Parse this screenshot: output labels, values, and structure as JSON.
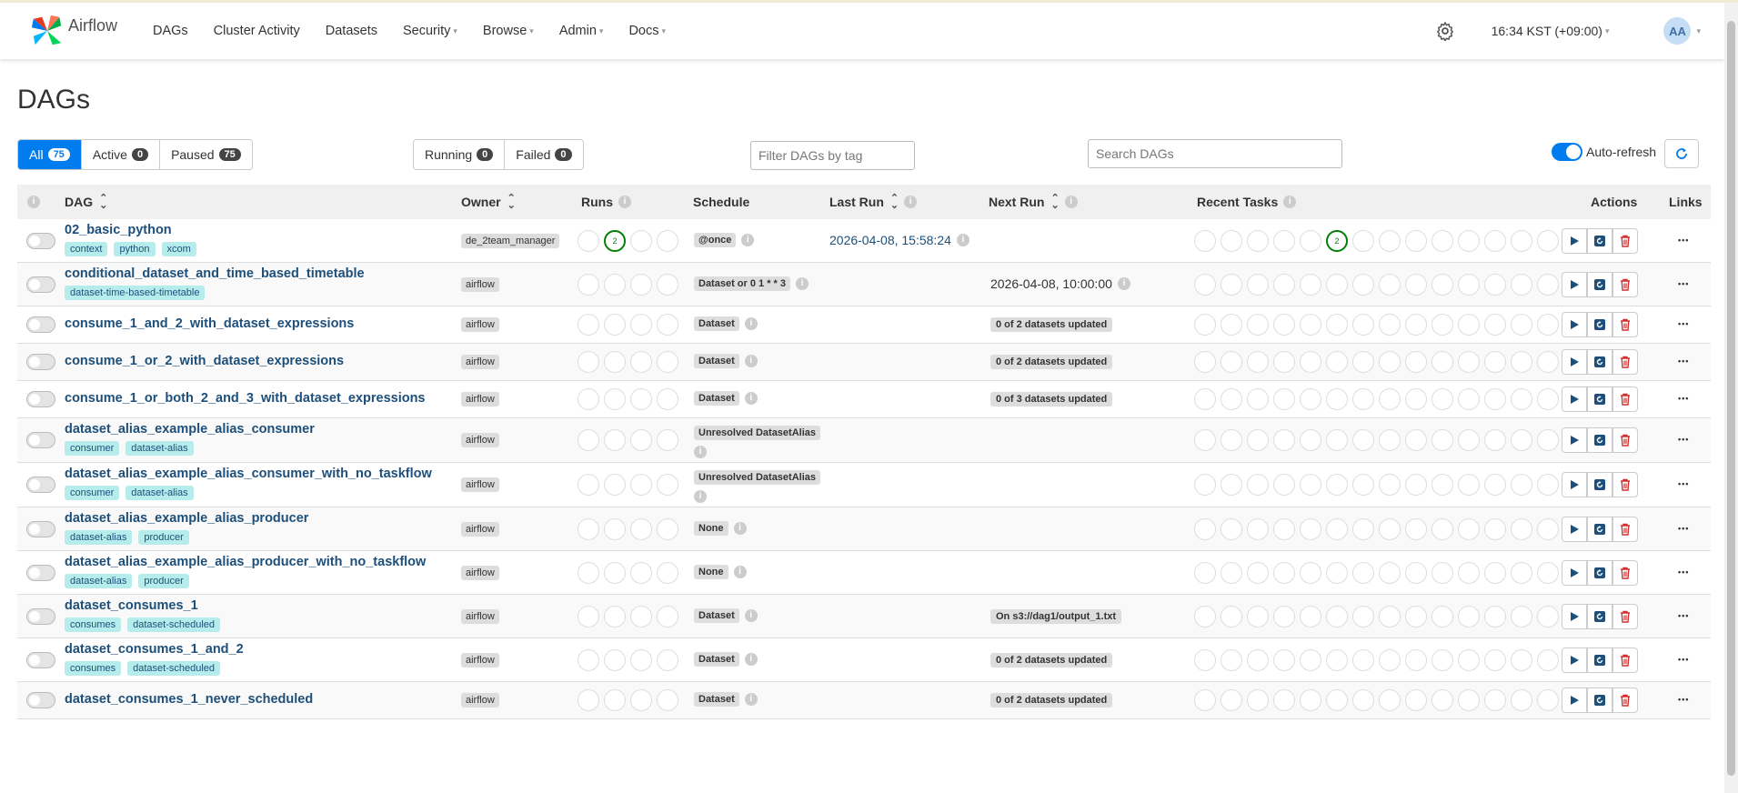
{
  "navbar": {
    "brand": "Airflow",
    "items": [
      {
        "label": "DAGs",
        "dropdown": false
      },
      {
        "label": "Cluster Activity",
        "dropdown": false
      },
      {
        "label": "Datasets",
        "dropdown": false
      },
      {
        "label": "Security",
        "dropdown": true
      },
      {
        "label": "Browse",
        "dropdown": true
      },
      {
        "label": "Admin",
        "dropdown": true
      },
      {
        "label": "Docs",
        "dropdown": true
      }
    ],
    "timezone": "16:34 KST (+09:00)",
    "user_initials": "AA"
  },
  "page": {
    "title": "DAGs",
    "status_filters": [
      {
        "label": "All",
        "count": "75"
      },
      {
        "label": "Active",
        "count": "0"
      },
      {
        "label": "Paused",
        "count": "75"
      }
    ],
    "run_filters": [
      {
        "label": "Running",
        "count": "0"
      },
      {
        "label": "Failed",
        "count": "0"
      }
    ],
    "tag_filter_placeholder": "Filter DAGs by tag",
    "search_placeholder": "Search DAGs",
    "auto_refresh_label": "Auto-refresh"
  },
  "table": {
    "headers": {
      "dag": "DAG",
      "owner": "Owner",
      "runs": "Runs",
      "schedule": "Schedule",
      "last_run": "Last Run",
      "next_run": "Next Run",
      "recent_tasks": "Recent Tasks",
      "actions": "Actions",
      "links": "Links"
    },
    "rows": [
      {
        "name": "02_basic_python",
        "tags": [
          "context",
          "python",
          "xcom"
        ],
        "owner": "de_2team_manager",
        "schedule": "@once",
        "last_run": "2026-04-08, 15:58:24",
        "next_run": "",
        "next_run_badge": "",
        "runs_success": "2",
        "tasks_success": "2"
      },
      {
        "name": "conditional_dataset_and_time_based_timetable",
        "tags": [
          "dataset-time-based-timetable"
        ],
        "owner": "airflow",
        "schedule": "Dataset or 0 1 * * 3",
        "last_run": "",
        "next_run": "2026-04-08, 10:00:00",
        "next_run_badge": "",
        "runs_success": "",
        "tasks_success": ""
      },
      {
        "name": "consume_1_and_2_with_dataset_expressions",
        "tags": [],
        "owner": "airflow",
        "schedule": "Dataset",
        "last_run": "",
        "next_run": "",
        "next_run_badge": "0 of 2 datasets updated",
        "runs_success": "",
        "tasks_success": ""
      },
      {
        "name": "consume_1_or_2_with_dataset_expressions",
        "tags": [],
        "owner": "airflow",
        "schedule": "Dataset",
        "last_run": "",
        "next_run": "",
        "next_run_badge": "0 of 2 datasets updated",
        "runs_success": "",
        "tasks_success": ""
      },
      {
        "name": "consume_1_or_both_2_and_3_with_dataset_expressions",
        "tags": [],
        "owner": "airflow",
        "schedule": "Dataset",
        "last_run": "",
        "next_run": "",
        "next_run_badge": "0 of 3 datasets updated",
        "runs_success": "",
        "tasks_success": ""
      },
      {
        "name": "dataset_alias_example_alias_consumer",
        "tags": [
          "consumer",
          "dataset-alias"
        ],
        "owner": "airflow",
        "schedule": "Unresolved DatasetAlias",
        "last_run": "",
        "next_run": "",
        "next_run_badge": "",
        "runs_success": "",
        "tasks_success": ""
      },
      {
        "name": "dataset_alias_example_alias_consumer_with_no_taskflow",
        "tags": [
          "consumer",
          "dataset-alias"
        ],
        "owner": "airflow",
        "schedule": "Unresolved DatasetAlias",
        "last_run": "",
        "next_run": "",
        "next_run_badge": "",
        "runs_success": "",
        "tasks_success": ""
      },
      {
        "name": "dataset_alias_example_alias_producer",
        "tags": [
          "dataset-alias",
          "producer"
        ],
        "owner": "airflow",
        "schedule": "None",
        "last_run": "",
        "next_run": "",
        "next_run_badge": "",
        "runs_success": "",
        "tasks_success": ""
      },
      {
        "name": "dataset_alias_example_alias_producer_with_no_taskflow",
        "tags": [
          "dataset-alias",
          "producer"
        ],
        "owner": "airflow",
        "schedule": "None",
        "last_run": "",
        "next_run": "",
        "next_run_badge": "",
        "runs_success": "",
        "tasks_success": ""
      },
      {
        "name": "dataset_consumes_1",
        "tags": [
          "consumes",
          "dataset-scheduled"
        ],
        "owner": "airflow",
        "schedule": "Dataset",
        "last_run": "",
        "next_run": "",
        "next_run_badge": "On s3://dag1/output_1.txt",
        "runs_success": "",
        "tasks_success": ""
      },
      {
        "name": "dataset_consumes_1_and_2",
        "tags": [
          "consumes",
          "dataset-scheduled"
        ],
        "owner": "airflow",
        "schedule": "Dataset",
        "last_run": "",
        "next_run": "",
        "next_run_badge": "0 of 2 datasets updated",
        "runs_success": "",
        "tasks_success": ""
      },
      {
        "name": "dataset_consumes_1_never_scheduled",
        "tags": [],
        "owner": "airflow",
        "schedule": "Dataset",
        "last_run": "",
        "next_run": "",
        "next_run_badge": "0 of 2 datasets updated",
        "runs_success": "",
        "tasks_success": ""
      }
    ]
  }
}
